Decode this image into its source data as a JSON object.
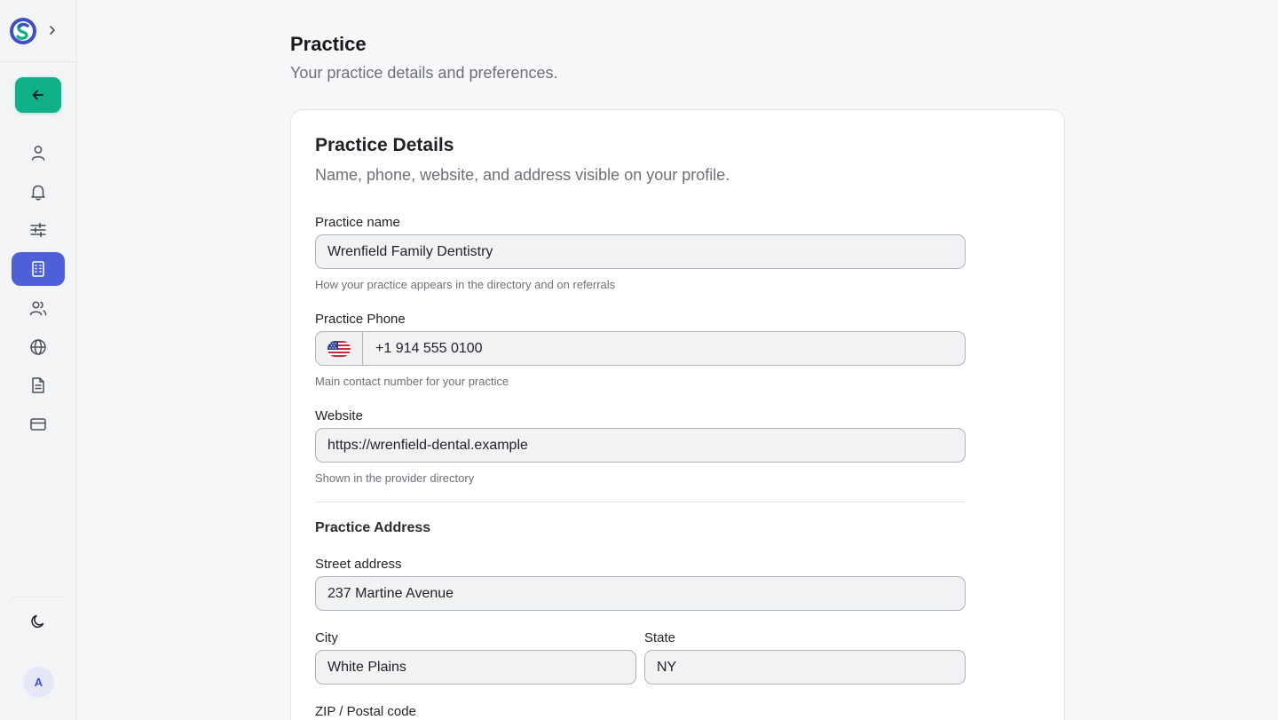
{
  "sidebar": {
    "avatar_initial": "A",
    "accent_color": "#4f5fd8",
    "back_color": "#10b08a",
    "items": [
      {
        "icon": "user-icon"
      },
      {
        "icon": "bell-icon"
      },
      {
        "icon": "sliders-icon"
      },
      {
        "icon": "building-icon",
        "active": true
      },
      {
        "icon": "users-icon"
      },
      {
        "icon": "globe-icon"
      },
      {
        "icon": "document-icon"
      },
      {
        "icon": "credit-card-icon"
      }
    ]
  },
  "header": {
    "title": "Practice",
    "subtitle": "Your practice details and preferences."
  },
  "card": {
    "title": "Practice Details",
    "description": "Name, phone, website, and address visible on your profile.",
    "practice_name": {
      "label": "Practice name",
      "value": "Wrenfield Family Dentistry",
      "helper": "How your practice appears in the directory and on referrals"
    },
    "phone": {
      "label": "Practice Phone",
      "country_icon": "us-flag-icon",
      "value": "+1 914 555 0100",
      "helper": "Main contact number for your practice"
    },
    "website": {
      "label": "Website",
      "value": "https://wrenfield-dental.example",
      "helper": "Shown in the provider directory"
    },
    "address": {
      "heading": "Practice Address",
      "street_label": "Street address",
      "street_value": "237 Martine Avenue",
      "city_label": "City",
      "city_value": "White Plains",
      "state_label": "State",
      "state_value": "NY",
      "zip_label": "ZIP / Postal code"
    }
  }
}
